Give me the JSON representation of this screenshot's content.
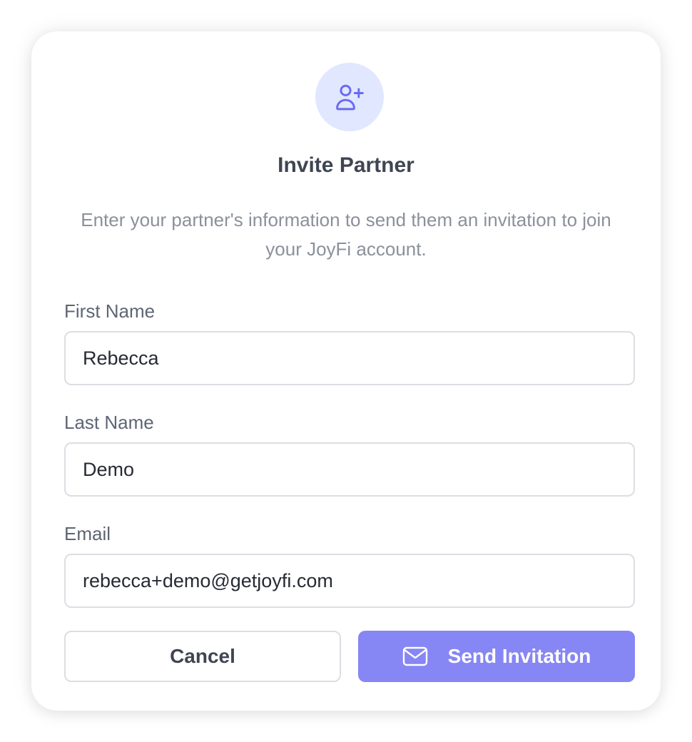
{
  "dialog": {
    "title": "Invite Partner",
    "description": "Enter your partner's information to send them an invitation to join your JoyFi account.",
    "header_icon": "user-plus-icon"
  },
  "form": {
    "first_name": {
      "label": "First Name",
      "value": "Rebecca"
    },
    "last_name": {
      "label": "Last Name",
      "value": "Demo"
    },
    "email": {
      "label": "Email",
      "value": "rebecca+demo@getjoyfi.com"
    }
  },
  "actions": {
    "cancel_label": "Cancel",
    "send_label": "Send Invitation",
    "send_icon": "mail-icon"
  },
  "colors": {
    "accent": "#8686f5",
    "icon_bg": "#e0e7ff",
    "icon_stroke": "#6a6af0"
  }
}
